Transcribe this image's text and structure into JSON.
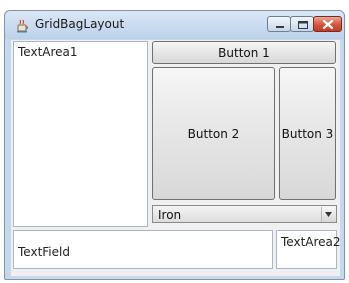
{
  "window": {
    "title": "GridBagLayout",
    "icon": "java-cup-icon"
  },
  "controls": {
    "minimize": "minimize-icon",
    "maximize": "maximize-icon",
    "close": "close-icon"
  },
  "content": {
    "textarea1": "TextArea1",
    "button1": "Button 1",
    "button2": "Button 2",
    "button3": "Button 3",
    "combo_selected": "Iron",
    "textfield": "TextField",
    "textarea2": "TextArea2"
  },
  "colors": {
    "titlebar": "#cbdcf0",
    "close_button": "#d55a45",
    "panel": "#f0f0f0"
  }
}
